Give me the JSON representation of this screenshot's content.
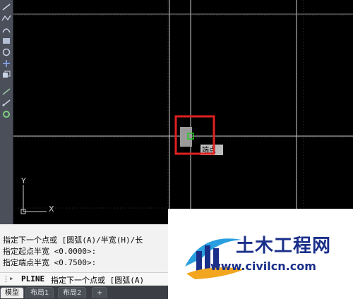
{
  "toolbar": {
    "tools": [
      "line-icon",
      "polyline-icon",
      "arc-icon",
      "rectangle-icon",
      "circle-icon",
      "move-icon",
      "copy-icon",
      "stretch-icon",
      "scale-icon",
      "offset-icon"
    ]
  },
  "canvas": {
    "tooltip_text": "端点",
    "ucs_x_label": "X",
    "ucs_y_label": "Y",
    "colors": {
      "background": "#000000",
      "grid": "#3a3a3a",
      "crosshair": "#d9d9d9",
      "highlight": "#e02020",
      "snap": "#22cc22"
    }
  },
  "command": {
    "history": [
      "指定下一个点或 [圆弧(A)/半宽(H)/长",
      "指定起点半宽 <0.0000>:",
      "指定端点半宽 <0.7500>:"
    ],
    "prompt_command": "PLINE",
    "prompt_text": "指定下一个点或 [圆弧(A)"
  },
  "tabs": [
    {
      "label": "模型",
      "active": true
    },
    {
      "label": "布局1",
      "active": false
    },
    {
      "label": "布局2",
      "active": false
    },
    {
      "label": "+",
      "active": false
    }
  ],
  "watermark": {
    "title": "土木工程网",
    "url": "www.civilcn.com"
  }
}
